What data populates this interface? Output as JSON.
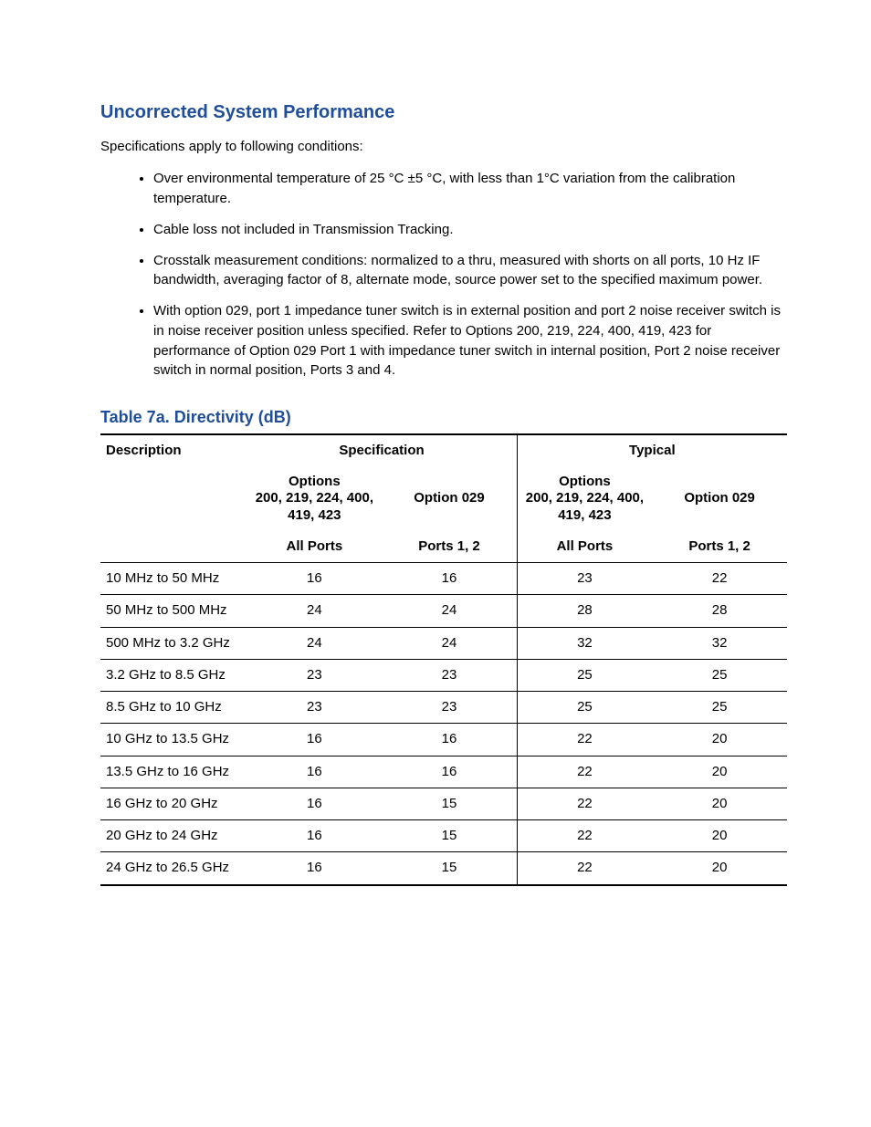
{
  "heading": "Uncorrected System Performance",
  "intro": "Specifications apply to following conditions:",
  "conditions": [
    "Over environmental temperature of 25 °C ±5 °C, with less than 1°C variation from the calibration temperature.",
    "Cable loss not included in Transmission Tracking.",
    "Crosstalk measurement conditions: normalized to a thru, measured with shorts on all ports, 10 Hz IF bandwidth, averaging factor of 8, alternate mode, source power set to the specified maximum power.",
    "With option 029, port 1 impedance tuner switch is in external position and port 2 noise receiver switch is in noise receiver position unless specified. Refer to Options 200, 219, 224, 400, 419, 423 for performance of Option 029 Port 1 with impedance tuner switch in internal position, Port 2 noise receiver switch in normal position, Ports 3 and 4."
  ],
  "table": {
    "caption": "Table 7a. Directivity (dB)",
    "head": {
      "desc": "Description",
      "spec": "Specification",
      "typical": "Typical",
      "optionsA": "Options\n200, 219, 224, 400,\n419, 423",
      "option029": "Option 029",
      "allports": "All Ports",
      "ports12": "Ports 1, 2"
    },
    "rows": [
      {
        "desc": "10 MHz to 50 MHz",
        "specA": "16",
        "specB": "16",
        "typA": "23",
        "typB": "22"
      },
      {
        "desc": "50 MHz to 500 MHz",
        "specA": "24",
        "specB": "24",
        "typA": "28",
        "typB": "28"
      },
      {
        "desc": "500 MHz to 3.2 GHz",
        "specA": "24",
        "specB": "24",
        "typA": "32",
        "typB": "32"
      },
      {
        "desc": "3.2 GHz to 8.5 GHz",
        "specA": "23",
        "specB": "23",
        "typA": "25",
        "typB": "25"
      },
      {
        "desc": "8.5 GHz to 10 GHz",
        "specA": "23",
        "specB": "23",
        "typA": "25",
        "typB": "25"
      },
      {
        "desc": "10 GHz to 13.5 GHz",
        "specA": "16",
        "specB": "16",
        "typA": "22",
        "typB": "20"
      },
      {
        "desc": "13.5 GHz to 16 GHz",
        "specA": "16",
        "specB": "16",
        "typA": "22",
        "typB": "20"
      },
      {
        "desc": "16 GHz to 20 GHz",
        "specA": "16",
        "specB": "15",
        "typA": "22",
        "typB": "20"
      },
      {
        "desc": "20 GHz to 24 GHz",
        "specA": "16",
        "specB": "15",
        "typA": "22",
        "typB": "20"
      },
      {
        "desc": "24 GHz to 26.5 GHz",
        "specA": "16",
        "specB": "15",
        "typA": "22",
        "typB": "20"
      }
    ]
  },
  "chart_data": {
    "type": "table",
    "title": "Table 7a. Directivity (dB)",
    "columns": [
      "Description",
      "Spec – Options 200/219/224/400/419/423 – All Ports",
      "Spec – Option 029 – Ports 1,2",
      "Typical – Options 200/219/224/400/419/423 – All Ports",
      "Typical – Option 029 – Ports 1,2"
    ],
    "rows": [
      [
        "10 MHz to 50 MHz",
        16,
        16,
        23,
        22
      ],
      [
        "50 MHz to 500 MHz",
        24,
        24,
        28,
        28
      ],
      [
        "500 MHz to 3.2 GHz",
        24,
        24,
        32,
        32
      ],
      [
        "3.2 GHz to 8.5 GHz",
        23,
        23,
        25,
        25
      ],
      [
        "8.5 GHz to 10 GHz",
        23,
        23,
        25,
        25
      ],
      [
        "10 GHz to 13.5 GHz",
        16,
        16,
        22,
        20
      ],
      [
        "13.5 GHz to 16 GHz",
        16,
        16,
        22,
        20
      ],
      [
        "16 GHz to 20 GHz",
        16,
        15,
        22,
        20
      ],
      [
        "20 GHz to 24 GHz",
        16,
        15,
        22,
        20
      ],
      [
        "24 GHz to 26.5 GHz",
        16,
        15,
        22,
        20
      ]
    ]
  }
}
